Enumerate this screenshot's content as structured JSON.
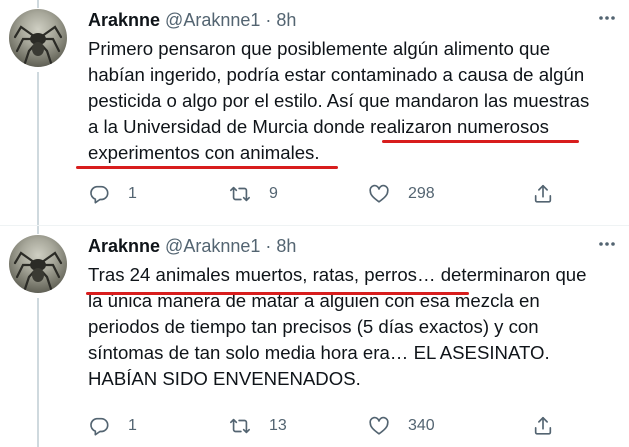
{
  "tweets": [
    {
      "name": "Araknne",
      "handle": "@Araknne1",
      "separator": "·",
      "time": "8h",
      "text": "Primero pensaron que posiblemente algún alimento que\nhabían ingerido, podría estar contaminado a causa de algún\npesticida o algo por el estilo. Así que mandaron las muestras\na la Universidad de Murcia donde realizaron numerosos\nexperimentos con animales.",
      "replies": "1",
      "retweets": "9",
      "likes": "298"
    },
    {
      "name": "Araknne",
      "handle": "@Araknne1",
      "separator": "·",
      "time": "8h",
      "text": "Tras 24 animales muertos, ratas, perros… determinaron que\nla única manera de matar a alguien con esa mezcla en\nperiodos de tiempo tan precisos (5 días exactos) y con\nsíntomas de tan solo media hora era… EL ASESINATO.\nHABÍAN SIDO ENVENENADOS.",
      "replies": "1",
      "retweets": "13",
      "likes": "340"
    }
  ],
  "colors": {
    "underline": "#d81d1d",
    "text": "#0f1419",
    "muted": "#536471",
    "thread": "#cfd9de"
  },
  "icons": [
    "more-icon",
    "reply-icon",
    "retweet-icon",
    "like-icon",
    "share-icon"
  ]
}
